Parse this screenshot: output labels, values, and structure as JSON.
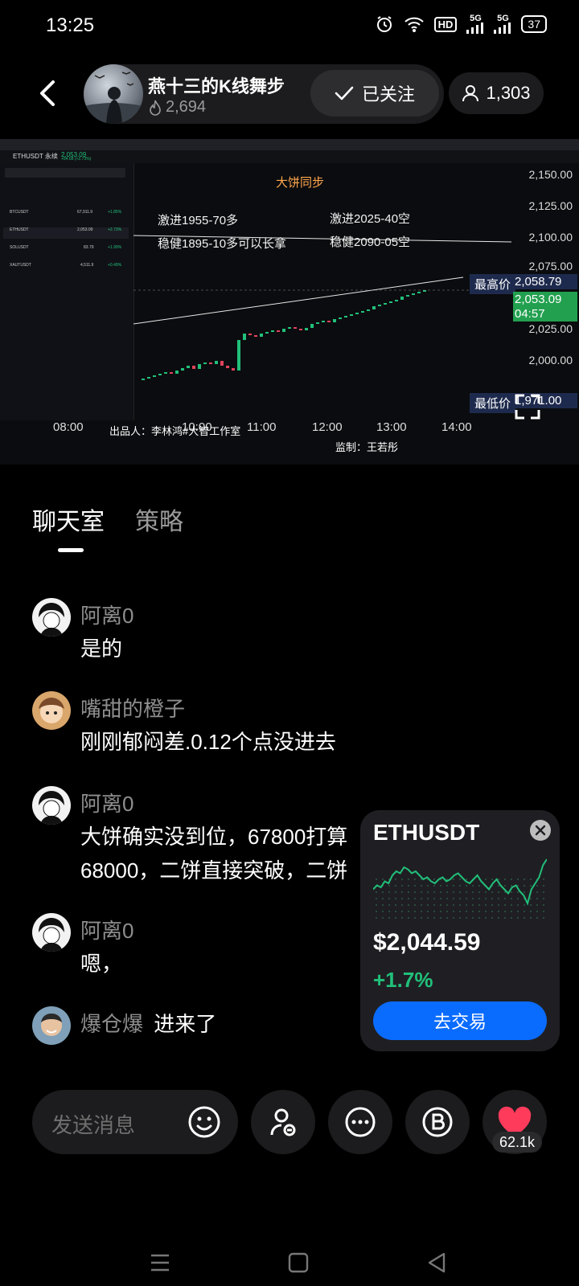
{
  "status_bar": {
    "time": "13:25",
    "icons": [
      "alarm-icon",
      "wifi-icon",
      "hd-icon",
      "5g-signal-icon",
      "5g-signal-icon",
      "battery-icon"
    ],
    "hd_label": "HD",
    "net_1": "5G",
    "net_2": "5G",
    "battery": "37"
  },
  "header": {
    "host_name": "燕十三的K线舞步",
    "host_heat": "2,694",
    "follow_label": "已关注",
    "viewer_count": "1,303"
  },
  "stream": {
    "top_symbol": "ETHUSDT 永续",
    "top_price": "2,053.09",
    "top_change": "+54.68 (+2.73%)",
    "watchlist": [
      {
        "symbol": "BTCUSDT",
        "value": "67,911.9",
        "change": "+1.85%"
      },
      {
        "symbol": "ETHUSDT",
        "value": "2,053.09",
        "change": "+2.73%"
      },
      {
        "symbol": "SOLUSDT",
        "value": "83.79",
        "change": "+1.99%"
      },
      {
        "symbol": "XAUTUSDT",
        "value": "4,511.9",
        "change": "+0.49%"
      }
    ],
    "annotations": {
      "title": "大饼同步",
      "aggressive_long": "激进1955-70多",
      "steady_long": "稳健1895-10多可以长拿",
      "aggressive_short": "激进2025-40空",
      "steady_short": "稳健2090-05空"
    },
    "y_ticks": [
      "2,150.00",
      "2,125.00",
      "2,100.00",
      "2,075.00",
      "2,025.00",
      "2,000.00"
    ],
    "x_ticks": [
      "08:00",
      "10:00",
      "11:00",
      "12:00",
      "13:00",
      "14:00"
    ],
    "high_label": "最高价",
    "high_value": "2,058.79",
    "current_price": "2,053.09",
    "countdown": "04:57",
    "low_label": "最低价",
    "low_value": "1,971.00",
    "credit_left": "出品人：李林鸿#大智工作室",
    "credit_right": "监制：王若彤"
  },
  "tabs": [
    {
      "label": "聊天室",
      "active": true
    },
    {
      "label": "策略",
      "active": false
    }
  ],
  "messages": [
    {
      "user": "阿离0",
      "text": "是的"
    },
    {
      "user": "嘴甜的橙子",
      "text": "刚刚郁闷差.0.12个点没进去"
    },
    {
      "user": "阿离0",
      "text": "大饼确实没到位，67800打算",
      "text2": "68000，二饼直接突破，二饼"
    },
    {
      "user": "阿离0",
      "text": "嗯，"
    },
    {
      "user": "爆仓爆",
      "text": "进来了"
    }
  ],
  "mini_card": {
    "symbol": "ETHUSDT",
    "price": "$2,044.59",
    "change": "+1.7%",
    "button": "去交易",
    "accent": "#21c07a",
    "button_color": "#0a6cff"
  },
  "mini_chart": {
    "type": "line",
    "values": [
      30,
      34,
      32,
      38,
      36,
      44,
      48,
      46,
      52,
      50,
      46,
      48,
      44,
      40,
      42,
      38,
      36,
      40,
      42,
      38,
      40,
      44,
      46,
      42,
      38,
      36,
      40,
      44,
      38,
      34,
      30,
      36,
      40,
      34,
      30,
      26,
      32,
      34,
      28,
      24,
      16,
      30,
      36,
      42,
      54,
      60
    ]
  },
  "bottom_bar": {
    "placeholder": "发送消息",
    "like_count": "62.1k"
  },
  "colors": {
    "background": "#000000",
    "like_heart": "#ff3b5c",
    "candle_up": "#21c07a",
    "candle_down": "#e0445a"
  }
}
